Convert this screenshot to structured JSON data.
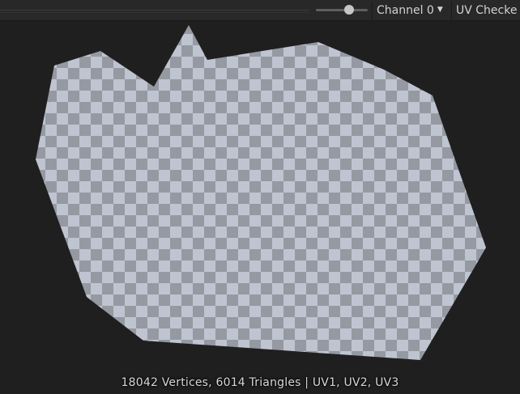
{
  "toolbar": {
    "channel_label": "Channel 0",
    "texture_label": "UV Checke",
    "icons": {
      "channel_arrow": "triangle-down-icon"
    }
  },
  "status": {
    "text": "18042 Vertices, 6014 Triangles | UV1, UV2, UV3"
  },
  "colors": {
    "checker_light": "#bfc4d1",
    "checker_dark": "#9599a1",
    "background": "#1f1f1f"
  }
}
